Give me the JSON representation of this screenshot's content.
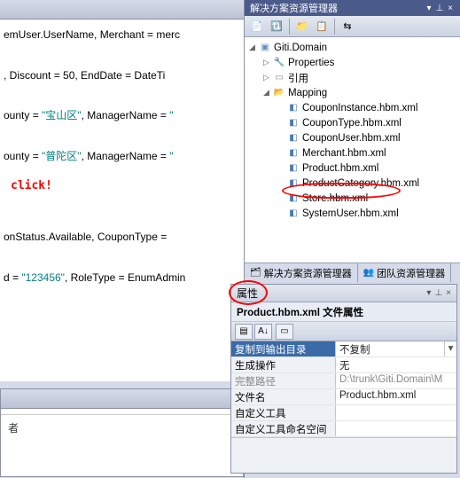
{
  "code": {
    "line1a": "emUser.UserName, Merchant = merc",
    "line2": ", Discount = 50, EndDate = DateTi",
    "line3a": "ounty = ",
    "line3b": "\"宝山区\"",
    "line3c": ", ManagerName = ",
    "line4a": "ounty = ",
    "line4b": "\"普陀区\"",
    "line4c": ", ManagerName = ",
    "line5": "onStatus.Available, CouponType = ",
    "line6a": "d = ",
    "line6b": "\"123456\"",
    "line6c": ", RoleType = EnumAdmin"
  },
  "click_annotation": "click!",
  "bottom": {
    "cell": "者"
  },
  "solution_explorer": {
    "title": "解决方案资源管理器",
    "tree": {
      "root": "Giti.Domain",
      "properties": "Properties",
      "references": "引用",
      "mapping": "Mapping",
      "files": [
        "CouponInstance.hbm.xml",
        "CouponType.hbm.xml",
        "CouponUser.hbm.xml",
        "Merchant.hbm.xml",
        "Product.hbm.xml",
        "ProductCategory.hbm.xml",
        "Store.hbm.xml",
        "SystemUser.hbm.xml"
      ]
    },
    "tabs": {
      "sol": "解决方案资源管理器",
      "team": "团队资源管理器"
    }
  },
  "properties": {
    "title": "属性",
    "subtitle": "Product.hbm.xml 文件属性",
    "rows": [
      {
        "name": "复制到输出目录",
        "value": "不复制",
        "selected": true,
        "dropdown": true
      },
      {
        "name": "生成操作",
        "value": "无"
      },
      {
        "name": "完整路径",
        "value": "D:\\trunk\\Giti.Domain\\M"
      },
      {
        "name": "文件名",
        "value": "Product.hbm.xml"
      },
      {
        "name": "自定义工具",
        "value": ""
      },
      {
        "name": "自定义工具命名空间",
        "value": ""
      }
    ]
  }
}
